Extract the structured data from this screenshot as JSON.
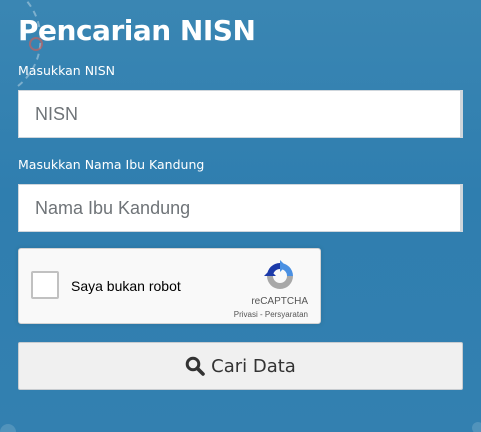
{
  "form": {
    "title": "Pencarian NISN",
    "nisn_label": "Masukkan NISN",
    "nisn_placeholder": "NISN",
    "nisn_value": "",
    "mother_name_label": "Masukkan Nama Ibu Kandung",
    "mother_name_placeholder": "Nama Ibu Kandung",
    "mother_name_value": ""
  },
  "recaptcha": {
    "checkbox_label": "Saya bukan robot",
    "checked": false,
    "brand": "reCAPTCHA",
    "privacy_link": "Privasi",
    "separator": " - ",
    "terms_link": "Persyaratan",
    "logo_icon": "recaptcha-logo-icon"
  },
  "search_button": {
    "label": "Cari Data",
    "icon": "search-icon"
  },
  "colors": {
    "background": "#3380b0",
    "title_text": "#ffffff",
    "button_bg": "#f0f0f0",
    "recaptcha_blue": "#4a90e2",
    "recaptcha_gray": "#a8a8a8"
  }
}
